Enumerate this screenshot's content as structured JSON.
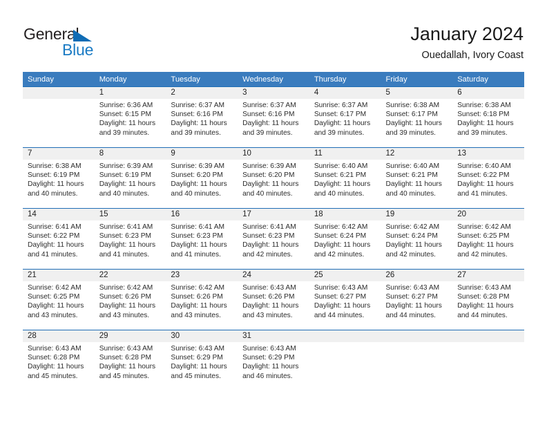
{
  "brand": {
    "name_part1": "General",
    "name_part2": "Blue",
    "color_dark": "#231f20",
    "color_blue": "#1b7bc4"
  },
  "header": {
    "title": "January 2024",
    "subtitle": "Ouedallah, Ivory Coast"
  },
  "theme": {
    "header_bg": "#3a7cbe",
    "row_divider": "#1f6db5",
    "daynum_bg": "#f0f0f0",
    "text": "#2b2b2b"
  },
  "calendar": {
    "weekday_headers": [
      "Sunday",
      "Monday",
      "Tuesday",
      "Wednesday",
      "Thursday",
      "Friday",
      "Saturday"
    ],
    "weeks": [
      [
        {
          "day": "",
          "sunrise": "",
          "sunset": "",
          "daylight1": "",
          "daylight2": "",
          "empty": true
        },
        {
          "day": "1",
          "sunrise": "Sunrise: 6:36 AM",
          "sunset": "Sunset: 6:15 PM",
          "daylight1": "Daylight: 11 hours",
          "daylight2": "and 39 minutes."
        },
        {
          "day": "2",
          "sunrise": "Sunrise: 6:37 AM",
          "sunset": "Sunset: 6:16 PM",
          "daylight1": "Daylight: 11 hours",
          "daylight2": "and 39 minutes."
        },
        {
          "day": "3",
          "sunrise": "Sunrise: 6:37 AM",
          "sunset": "Sunset: 6:16 PM",
          "daylight1": "Daylight: 11 hours",
          "daylight2": "and 39 minutes."
        },
        {
          "day": "4",
          "sunrise": "Sunrise: 6:37 AM",
          "sunset": "Sunset: 6:17 PM",
          "daylight1": "Daylight: 11 hours",
          "daylight2": "and 39 minutes."
        },
        {
          "day": "5",
          "sunrise": "Sunrise: 6:38 AM",
          "sunset": "Sunset: 6:17 PM",
          "daylight1": "Daylight: 11 hours",
          "daylight2": "and 39 minutes."
        },
        {
          "day": "6",
          "sunrise": "Sunrise: 6:38 AM",
          "sunset": "Sunset: 6:18 PM",
          "daylight1": "Daylight: 11 hours",
          "daylight2": "and 39 minutes."
        }
      ],
      [
        {
          "day": "7",
          "sunrise": "Sunrise: 6:38 AM",
          "sunset": "Sunset: 6:19 PM",
          "daylight1": "Daylight: 11 hours",
          "daylight2": "and 40 minutes."
        },
        {
          "day": "8",
          "sunrise": "Sunrise: 6:39 AM",
          "sunset": "Sunset: 6:19 PM",
          "daylight1": "Daylight: 11 hours",
          "daylight2": "and 40 minutes."
        },
        {
          "day": "9",
          "sunrise": "Sunrise: 6:39 AM",
          "sunset": "Sunset: 6:20 PM",
          "daylight1": "Daylight: 11 hours",
          "daylight2": "and 40 minutes."
        },
        {
          "day": "10",
          "sunrise": "Sunrise: 6:39 AM",
          "sunset": "Sunset: 6:20 PM",
          "daylight1": "Daylight: 11 hours",
          "daylight2": "and 40 minutes."
        },
        {
          "day": "11",
          "sunrise": "Sunrise: 6:40 AM",
          "sunset": "Sunset: 6:21 PM",
          "daylight1": "Daylight: 11 hours",
          "daylight2": "and 40 minutes."
        },
        {
          "day": "12",
          "sunrise": "Sunrise: 6:40 AM",
          "sunset": "Sunset: 6:21 PM",
          "daylight1": "Daylight: 11 hours",
          "daylight2": "and 40 minutes."
        },
        {
          "day": "13",
          "sunrise": "Sunrise: 6:40 AM",
          "sunset": "Sunset: 6:22 PM",
          "daylight1": "Daylight: 11 hours",
          "daylight2": "and 41 minutes."
        }
      ],
      [
        {
          "day": "14",
          "sunrise": "Sunrise: 6:41 AM",
          "sunset": "Sunset: 6:22 PM",
          "daylight1": "Daylight: 11 hours",
          "daylight2": "and 41 minutes."
        },
        {
          "day": "15",
          "sunrise": "Sunrise: 6:41 AM",
          "sunset": "Sunset: 6:23 PM",
          "daylight1": "Daylight: 11 hours",
          "daylight2": "and 41 minutes."
        },
        {
          "day": "16",
          "sunrise": "Sunrise: 6:41 AM",
          "sunset": "Sunset: 6:23 PM",
          "daylight1": "Daylight: 11 hours",
          "daylight2": "and 41 minutes."
        },
        {
          "day": "17",
          "sunrise": "Sunrise: 6:41 AM",
          "sunset": "Sunset: 6:23 PM",
          "daylight1": "Daylight: 11 hours",
          "daylight2": "and 42 minutes."
        },
        {
          "day": "18",
          "sunrise": "Sunrise: 6:42 AM",
          "sunset": "Sunset: 6:24 PM",
          "daylight1": "Daylight: 11 hours",
          "daylight2": "and 42 minutes."
        },
        {
          "day": "19",
          "sunrise": "Sunrise: 6:42 AM",
          "sunset": "Sunset: 6:24 PM",
          "daylight1": "Daylight: 11 hours",
          "daylight2": "and 42 minutes."
        },
        {
          "day": "20",
          "sunrise": "Sunrise: 6:42 AM",
          "sunset": "Sunset: 6:25 PM",
          "daylight1": "Daylight: 11 hours",
          "daylight2": "and 42 minutes."
        }
      ],
      [
        {
          "day": "21",
          "sunrise": "Sunrise: 6:42 AM",
          "sunset": "Sunset: 6:25 PM",
          "daylight1": "Daylight: 11 hours",
          "daylight2": "and 43 minutes."
        },
        {
          "day": "22",
          "sunrise": "Sunrise: 6:42 AM",
          "sunset": "Sunset: 6:26 PM",
          "daylight1": "Daylight: 11 hours",
          "daylight2": "and 43 minutes."
        },
        {
          "day": "23",
          "sunrise": "Sunrise: 6:42 AM",
          "sunset": "Sunset: 6:26 PM",
          "daylight1": "Daylight: 11 hours",
          "daylight2": "and 43 minutes."
        },
        {
          "day": "24",
          "sunrise": "Sunrise: 6:43 AM",
          "sunset": "Sunset: 6:26 PM",
          "daylight1": "Daylight: 11 hours",
          "daylight2": "and 43 minutes."
        },
        {
          "day": "25",
          "sunrise": "Sunrise: 6:43 AM",
          "sunset": "Sunset: 6:27 PM",
          "daylight1": "Daylight: 11 hours",
          "daylight2": "and 44 minutes."
        },
        {
          "day": "26",
          "sunrise": "Sunrise: 6:43 AM",
          "sunset": "Sunset: 6:27 PM",
          "daylight1": "Daylight: 11 hours",
          "daylight2": "and 44 minutes."
        },
        {
          "day": "27",
          "sunrise": "Sunrise: 6:43 AM",
          "sunset": "Sunset: 6:28 PM",
          "daylight1": "Daylight: 11 hours",
          "daylight2": "and 44 minutes."
        }
      ],
      [
        {
          "day": "28",
          "sunrise": "Sunrise: 6:43 AM",
          "sunset": "Sunset: 6:28 PM",
          "daylight1": "Daylight: 11 hours",
          "daylight2": "and 45 minutes."
        },
        {
          "day": "29",
          "sunrise": "Sunrise: 6:43 AM",
          "sunset": "Sunset: 6:28 PM",
          "daylight1": "Daylight: 11 hours",
          "daylight2": "and 45 minutes."
        },
        {
          "day": "30",
          "sunrise": "Sunrise: 6:43 AM",
          "sunset": "Sunset: 6:29 PM",
          "daylight1": "Daylight: 11 hours",
          "daylight2": "and 45 minutes."
        },
        {
          "day": "31",
          "sunrise": "Sunrise: 6:43 AM",
          "sunset": "Sunset: 6:29 PM",
          "daylight1": "Daylight: 11 hours",
          "daylight2": "and 46 minutes."
        },
        {
          "day": "",
          "sunrise": "",
          "sunset": "",
          "daylight1": "",
          "daylight2": "",
          "empty": true
        },
        {
          "day": "",
          "sunrise": "",
          "sunset": "",
          "daylight1": "",
          "daylight2": "",
          "empty": true
        },
        {
          "day": "",
          "sunrise": "",
          "sunset": "",
          "daylight1": "",
          "daylight2": "",
          "empty": true
        }
      ]
    ]
  }
}
